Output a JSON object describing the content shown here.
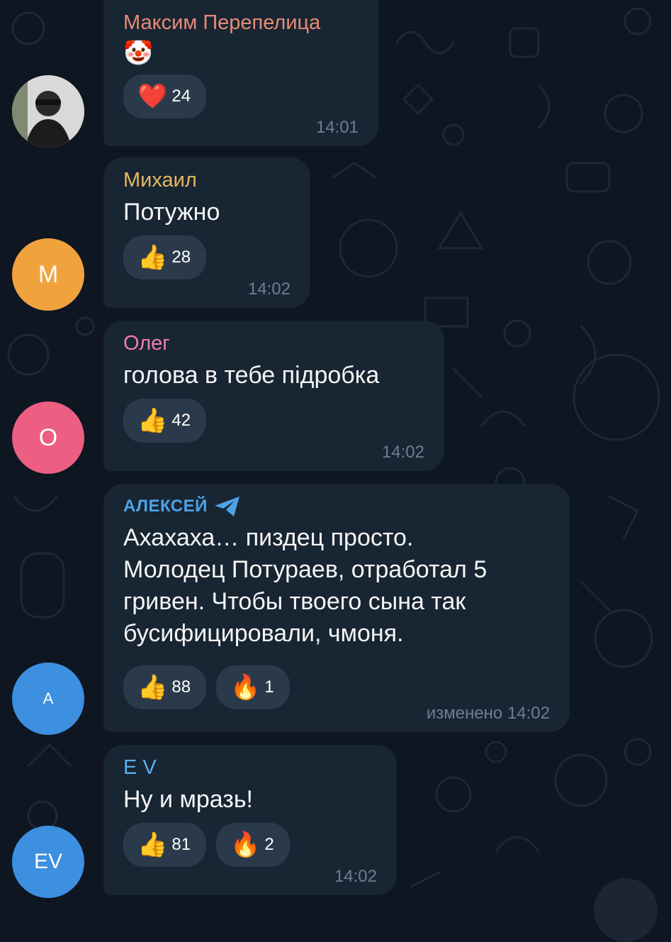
{
  "messages": [
    {
      "sender": "Максим Перепелица",
      "sender_color": "#e88a73",
      "text": "🤡",
      "reactions": [
        {
          "emoji": "❤️",
          "count": "24",
          "icon": "heart-icon"
        }
      ],
      "time": "14:01",
      "avatar": {
        "type": "photo",
        "initials": ""
      }
    },
    {
      "sender": "Михаил",
      "sender_color": "#e5b85f",
      "text": "Потужно",
      "reactions": [
        {
          "emoji": "👍",
          "count": "28",
          "icon": "thumbs-up-icon"
        }
      ],
      "time": "14:02",
      "avatar": {
        "initials": "М",
        "color": "#f0a33c"
      }
    },
    {
      "sender": "Олег",
      "sender_color": "#ef7fa6",
      "text": "голова в тебе підробка",
      "reactions": [
        {
          "emoji": "👍",
          "count": "42",
          "icon": "thumbs-up-icon"
        }
      ],
      "time": "14:02",
      "avatar": {
        "initials": "О",
        "color": "#ec5e82"
      }
    },
    {
      "sender": "АЛЕКСЕЙ",
      "sender_color": "#4ea3e6",
      "text": "Ахахаха… пиздец просто.\nМолодец Потураев, отработал 5\nгривен. Чтобы твоего сына так\nбусифицировали, чмоня.",
      "reactions": [
        {
          "emoji": "👍",
          "count": "88",
          "icon": "thumbs-up-icon"
        },
        {
          "emoji": "🔥",
          "count": "1",
          "icon": "fire-icon"
        }
      ],
      "time": "изменено 14:02",
      "avatar": {
        "initials": "A",
        "color": "#3d8fe0"
      }
    },
    {
      "sender": "E V",
      "sender_color": "#5ab0f0",
      "text": "Ну и мразь!",
      "reactions": [
        {
          "emoji": "👍",
          "count": "81",
          "icon": "thumbs-up-icon"
        },
        {
          "emoji": "🔥",
          "count": "2",
          "icon": "fire-icon"
        }
      ],
      "time": "14:02",
      "avatar": {
        "initials": "EV",
        "color": "#3d8fe0"
      }
    }
  ]
}
